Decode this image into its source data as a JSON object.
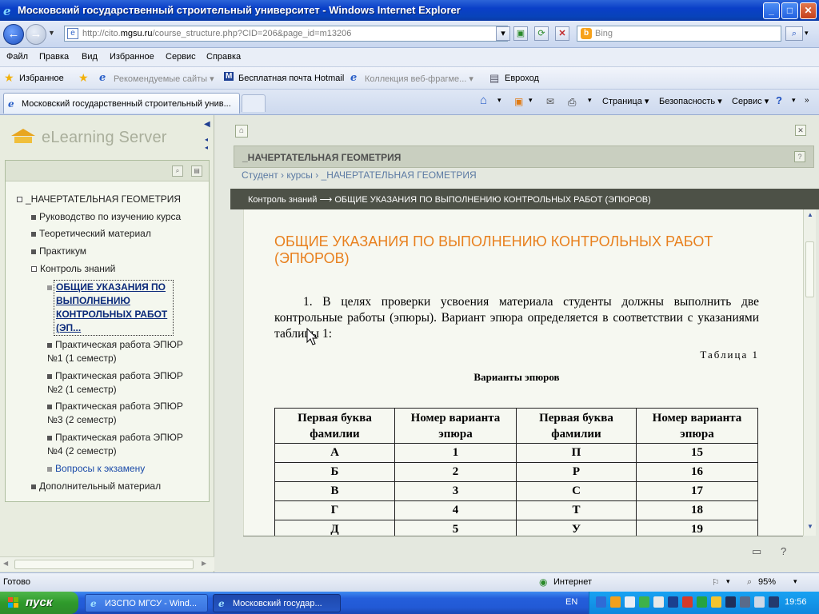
{
  "window": {
    "title": "Московский государственный строительный университет - Windows Internet Explorer",
    "buttons": {
      "minimize": "_",
      "maximize": "□",
      "close": "✕"
    }
  },
  "address_bar": {
    "url_prefix": "http://cito.",
    "url_domain": "mgsu.ru",
    "url_rest": "/course_structure.php?CID=206&page_id=m13206",
    "search_placeholder": "Bing"
  },
  "menu": [
    "Файл",
    "Правка",
    "Вид",
    "Избранное",
    "Сервис",
    "Справка"
  ],
  "favorites": {
    "label": "Избранное",
    "items": [
      {
        "label": "Рекомендуемые сайты ▾",
        "disabled": true
      },
      {
        "label": "Бесплатная почта Hotmail",
        "disabled": false
      },
      {
        "label": "Коллекция веб-фрагме... ▾",
        "disabled": true
      },
      {
        "label": "Евроход",
        "disabled": false
      }
    ]
  },
  "tab": {
    "label": "Московский государственный строительный унив...",
    "commands": [
      "Страница ▾",
      "Безопасность ▾",
      "Сервис ▾"
    ]
  },
  "left_panel": {
    "logo_text": "eLearning Server",
    "tree": [
      {
        "label": "_НАЧЕРТАТЕЛЬНАЯ ГЕОМЕТРИЯ",
        "level": 0,
        "state": "open"
      },
      {
        "label": "Руководство по изучению курса",
        "level": 1,
        "state": "leaf"
      },
      {
        "label": "Теоретический материал",
        "level": 1,
        "state": "leaf"
      },
      {
        "label": "Практикум",
        "level": 1,
        "state": "leaf"
      },
      {
        "label": "Контроль знаний",
        "level": 1,
        "state": "open"
      },
      {
        "label": "ОБЩИЕ УКАЗАНИЯ ПО ВЫПОЛНЕНИЮ КОНТРОЛЬНЫХ РАБОТ (ЭП...",
        "level": 2,
        "state": "current"
      },
      {
        "label": "Практическая работа ЭПЮР №1 (1 семестр)",
        "level": 2,
        "state": "leaf"
      },
      {
        "label": "Практическая работа ЭПЮР №2 (1 семестр)",
        "level": 2,
        "state": "leaf"
      },
      {
        "label": "Практическая работа ЭПЮР №3 (2 семестр)",
        "level": 2,
        "state": "leaf"
      },
      {
        "label": "Практическая работа ЭПЮР №4 (2 семестр)",
        "level": 2,
        "state": "leaf"
      },
      {
        "label": "Вопросы к экзамену",
        "level": 2,
        "state": "link"
      },
      {
        "label": "Дополнительный материал",
        "level": 1,
        "state": "leaf"
      }
    ]
  },
  "main": {
    "course_title": "_НАЧЕРТАТЕЛЬНАЯ ГЕОМЕТРИЯ",
    "breadcrumb": "Студент › курсы › _НАЧЕРТАТЕЛЬНАЯ ГЕОМЕТРИЯ",
    "path": "Контроль знаний ⟶ ОБЩИЕ УКАЗАНИЯ ПО ВЫПОЛНЕНИЮ КОНТРОЛЬНЫХ РАБОТ (ЭПЮРОВ)",
    "doc_title": "ОБЩИЕ УКАЗАНИЯ ПО ВЫПОЛНЕНИЮ КОНТРОЛЬНЫХ РАБОТ (ЭПЮРОВ)",
    "paragraph": "1. В целях проверки усвоения материала студенты должны выполнить две контрольные работы (эпюры). Вариант эпюра определяется в соответствии с указаниями таблицы 1:",
    "table_label": "Таблица 1",
    "table_title": "Варианты эпюров",
    "table": {
      "headers": [
        "Первая буква фамилии",
        "Номер варианта эпюра",
        "Первая буква фамилии",
        "Номер варианта эпюра"
      ],
      "rows": [
        [
          "А",
          "1",
          "П",
          "15"
        ],
        [
          "Б",
          "2",
          "Р",
          "16"
        ],
        [
          "В",
          "3",
          "С",
          "17"
        ],
        [
          "Г",
          "4",
          "Т",
          "18"
        ],
        [
          "Д",
          "5",
          "У",
          "19"
        ]
      ]
    }
  },
  "status": {
    "text": "Готово",
    "zone": "Интернет",
    "zoom": "95%"
  },
  "taskbar": {
    "start": "пуск",
    "items": [
      "ИЗСПО МГСУ - Wind...",
      "Московский государ..."
    ],
    "lang": "EN",
    "time": "19:56"
  },
  "colors": {
    "doc_title": "#e8801e",
    "path_bar": "#4d5147",
    "breadcrumb": "#5b7aa3"
  }
}
